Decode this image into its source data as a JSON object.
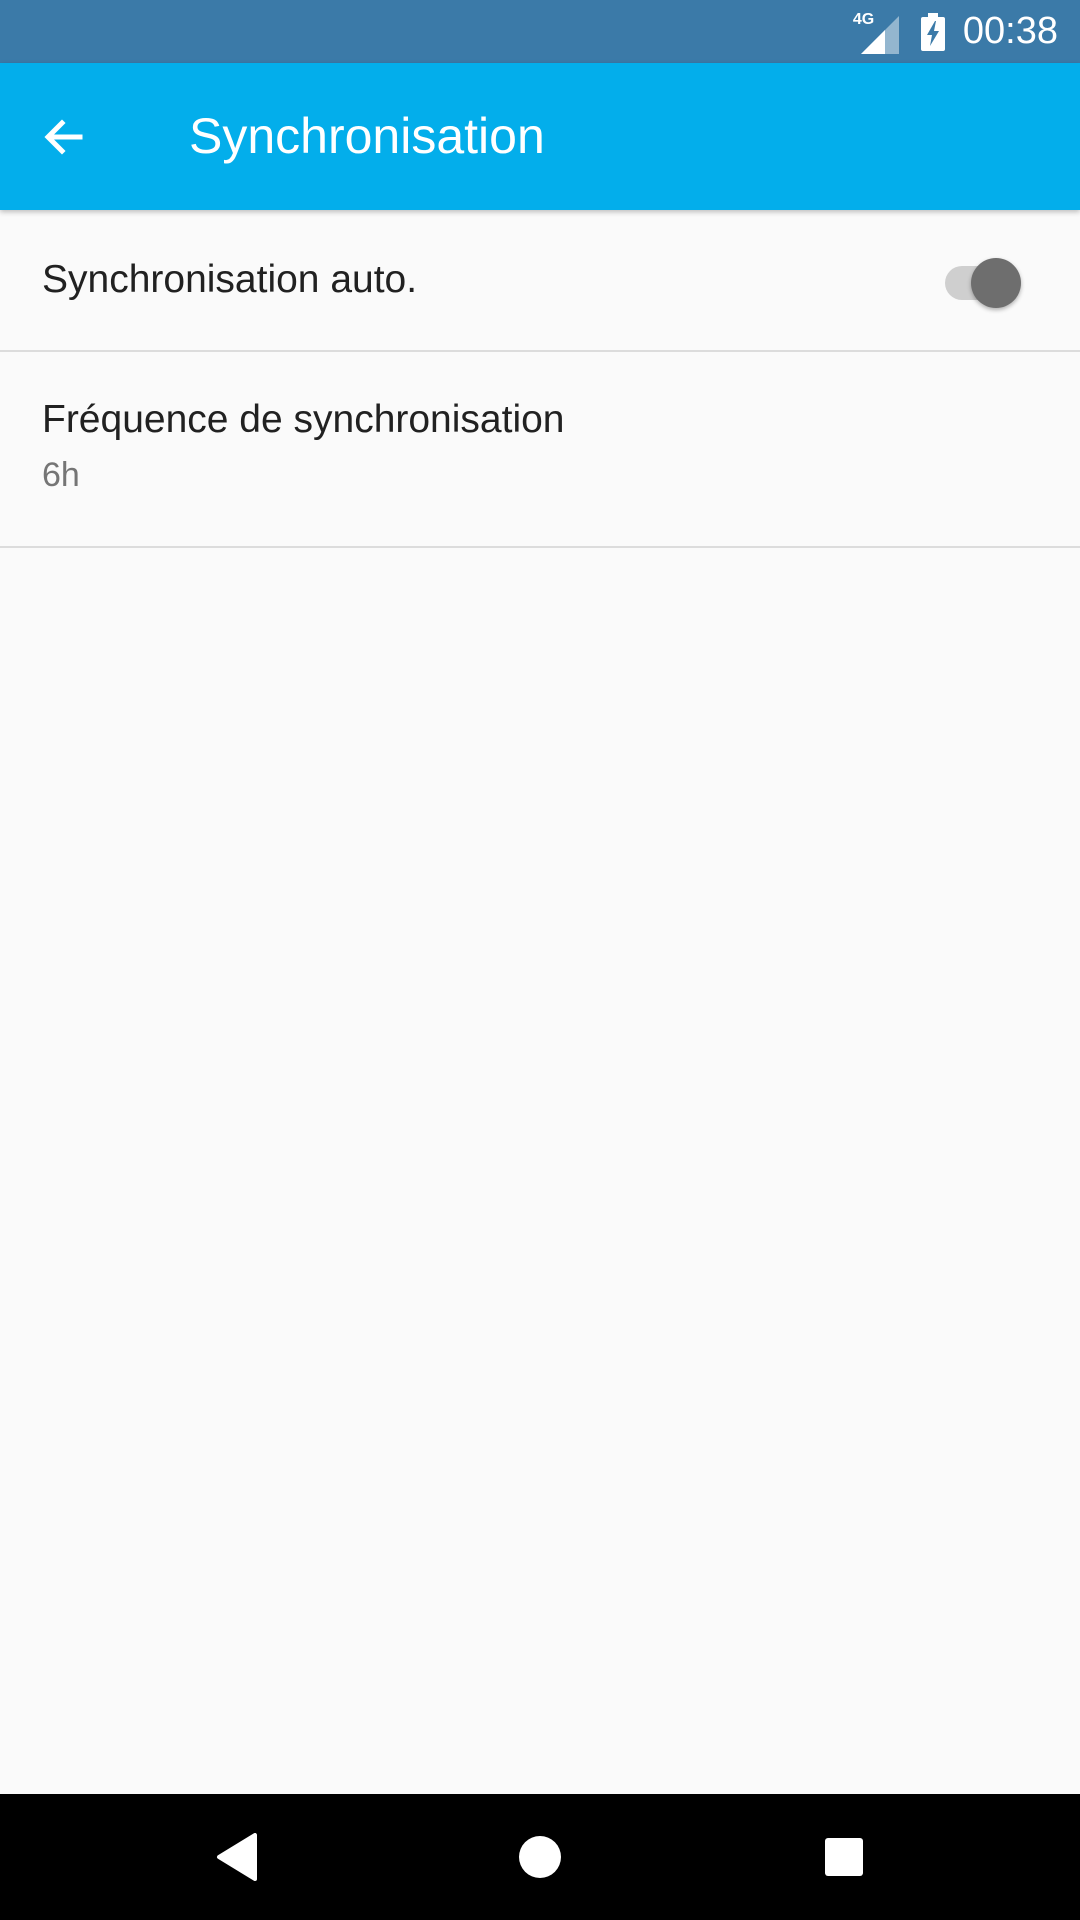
{
  "status_bar": {
    "network": "4G",
    "time": "00:38"
  },
  "app_bar": {
    "title": "Synchronisation",
    "back_icon": "arrow-back-icon"
  },
  "settings": {
    "auto_sync": {
      "title": "Synchronisation auto.",
      "enabled": false
    },
    "frequency": {
      "title": "Fréquence de synchronisation",
      "summary": "6h"
    }
  },
  "nav_bar": {
    "back_icon": "triangle-back-icon",
    "home_icon": "circle-home-icon",
    "recents_icon": "square-recents-icon"
  },
  "colors": {
    "status_bar": "#3b7aa8",
    "app_bar": "#03aeeb",
    "background": "#fafafa",
    "nav_bar": "#000000"
  }
}
